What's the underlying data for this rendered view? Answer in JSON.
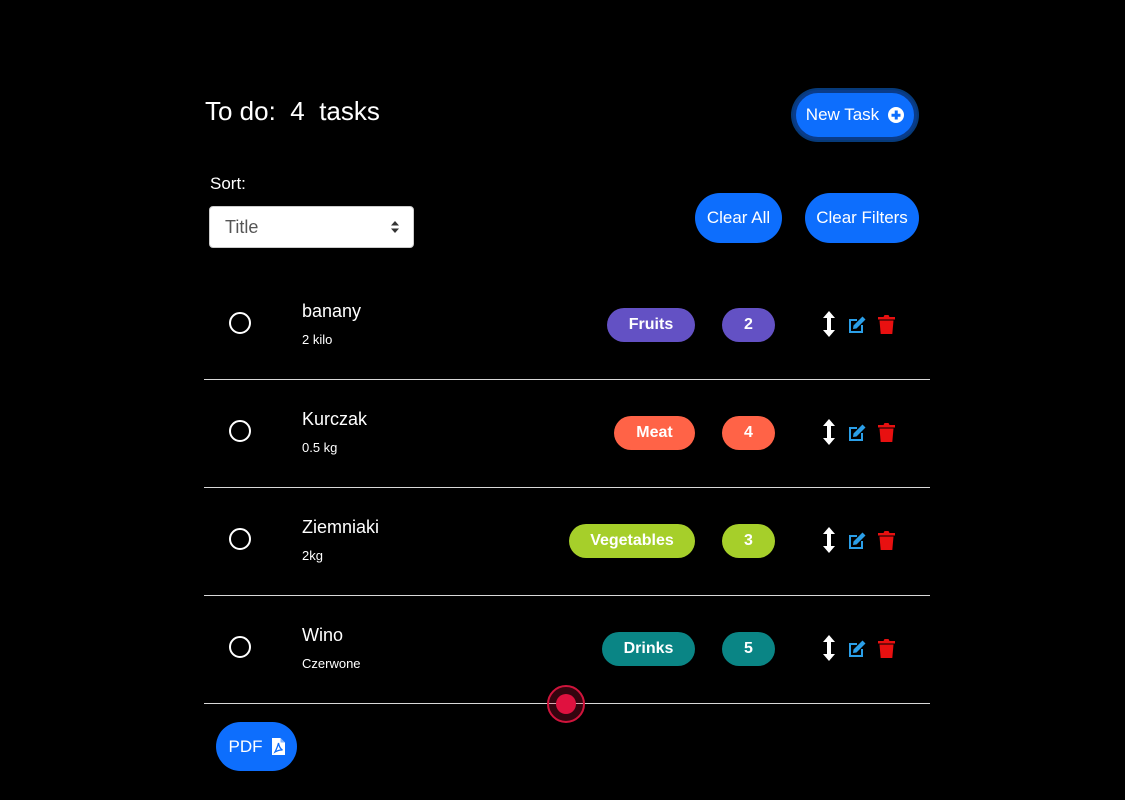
{
  "header": {
    "title_prefix": "To do:",
    "task_count": "4",
    "title_suffix": "tasks",
    "new_task_label": "New Task"
  },
  "sort": {
    "label": "Sort:",
    "selected": "Title"
  },
  "filters": {
    "clear_all_label": "Clear All",
    "clear_filters_label": "Clear Filters"
  },
  "tasks": [
    {
      "name": "banany",
      "description": "2 kilo",
      "category": "Fruits",
      "count": "2",
      "category_color": "#6351c4",
      "count_color": "#6351c4"
    },
    {
      "name": "Kurczak",
      "description": "0.5 kg",
      "category": "Meat",
      "count": "4",
      "category_color": "#ff6347",
      "count_color": "#ff6347"
    },
    {
      "name": "Ziemniaki",
      "description": "2kg",
      "category": "Vegetables",
      "count": "3",
      "category_color": "#a6cf2a",
      "count_color": "#a6cf2a"
    },
    {
      "name": "Wino",
      "description": "Czerwone",
      "category": "Drinks",
      "count": "5",
      "category_color": "#0a8585",
      "count_color": "#0a8585"
    }
  ],
  "footer": {
    "pdf_label": "PDF"
  },
  "icons": {
    "new_task": "plus-circle-icon",
    "sort": "sort-caret-icon",
    "move": "vertical-arrows-icon",
    "edit": "edit-icon",
    "delete": "trash-icon",
    "pdf": "pdf-file-icon"
  },
  "colors": {
    "primary": "#0d6efd",
    "edit": "#2b9fe8",
    "delete": "#e81010",
    "background": "#000000"
  }
}
